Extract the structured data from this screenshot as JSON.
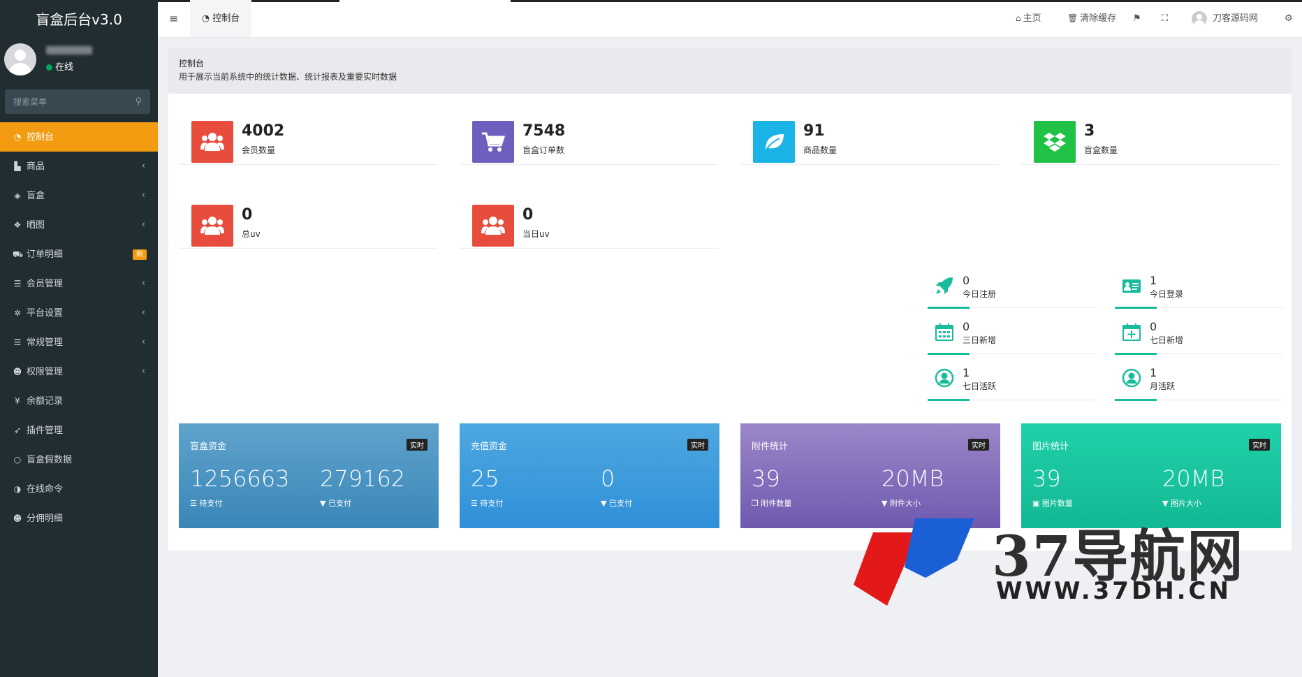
{
  "app": {
    "title": "盲盒后台v3.0"
  },
  "user": {
    "status": "在线",
    "top_name": "刀客源码网"
  },
  "sidebar": {
    "search_placeholder": "搜索菜单",
    "items": [
      {
        "label": "控制台",
        "icon": "dashboard-icon",
        "glyph": "◔",
        "chevron": "",
        "badge": ""
      },
      {
        "label": "商品",
        "icon": "shopping-bag-icon",
        "glyph": "▙",
        "chevron": "‹",
        "badge": ""
      },
      {
        "label": "盲盒",
        "icon": "cube-icon",
        "glyph": "◈",
        "chevron": "‹",
        "badge": ""
      },
      {
        "label": "晒图",
        "icon": "dropbox-icon",
        "glyph": "❖",
        "chevron": "‹",
        "badge": ""
      },
      {
        "label": "订单明细",
        "icon": "cart-icon",
        "glyph": "⛟",
        "chevron": "",
        "badge": "新"
      },
      {
        "label": "会员管理",
        "icon": "list-icon",
        "glyph": "☰",
        "chevron": "‹",
        "badge": ""
      },
      {
        "label": "平台设置",
        "icon": "cog-icon",
        "glyph": "✲",
        "chevron": "‹",
        "badge": ""
      },
      {
        "label": "常规管理",
        "icon": "database-icon",
        "glyph": "☰",
        "chevron": "‹",
        "badge": ""
      },
      {
        "label": "权限管理",
        "icon": "group-icon",
        "glyph": "☻",
        "chevron": "‹",
        "badge": ""
      },
      {
        "label": "余额记录",
        "icon": "yen-icon",
        "glyph": "¥",
        "chevron": "",
        "badge": ""
      },
      {
        "label": "插件管理",
        "icon": "rocket-icon",
        "glyph": "➶",
        "chevron": "",
        "badge": ""
      },
      {
        "label": "盲盒假数据",
        "icon": "circle-icon",
        "glyph": "○",
        "chevron": "",
        "badge": ""
      },
      {
        "label": "在线命令",
        "icon": "adjust-icon",
        "glyph": "◑",
        "chevron": "",
        "badge": ""
      },
      {
        "label": "分佣明细",
        "icon": "users-icon",
        "glyph": "☻",
        "chevron": "",
        "badge": ""
      }
    ]
  },
  "topbar": {
    "tab_label": "控制台",
    "home_label": "主页",
    "clear_cache_label": "清除缓存"
  },
  "page": {
    "title": "控制台",
    "description": "用于展示当前系统中的统计数据、统计报表及重要实时数据"
  },
  "stats": [
    {
      "value": "4002",
      "label": "会员数量",
      "color": "#e74c3c",
      "icon": "users-icon"
    },
    {
      "value": "7548",
      "label": "盲盒订单数",
      "color": "#6e5fbf",
      "icon": "cart-icon"
    },
    {
      "value": "91",
      "label": "商品数量",
      "color": "#1ab3e6",
      "icon": "leaf-icon"
    },
    {
      "value": "3",
      "label": "盲盒数量",
      "color": "#20c246",
      "icon": "dropbox-icon"
    },
    {
      "value": "0",
      "label": "总uv",
      "color": "#e74c3c",
      "icon": "users-icon"
    },
    {
      "value": "0",
      "label": "当日uv",
      "color": "#e74c3c",
      "icon": "users-icon"
    }
  ],
  "metrics": [
    {
      "value": "0",
      "label": "今日注册",
      "icon": "rocket-icon"
    },
    {
      "value": "1",
      "label": "今日登录",
      "icon": "vcard-icon"
    },
    {
      "value": "0",
      "label": "三日新增",
      "icon": "calendar-icon"
    },
    {
      "value": "0",
      "label": "七日新增",
      "icon": "calendar-plus-icon"
    },
    {
      "value": "1",
      "label": "七日活跃",
      "icon": "user-circle-icon"
    },
    {
      "value": "1",
      "label": "月活跃",
      "icon": "user-circle-icon"
    }
  ],
  "cards": [
    {
      "title": "盲盒资金",
      "tag": "实时",
      "v1": "1256663",
      "l1": "待支付",
      "v2": "279162",
      "l2": "已支付",
      "from": "#5fa3cc",
      "to": "#3a86b8"
    },
    {
      "title": "充值资金",
      "tag": "实时",
      "v1": "25",
      "l1": "待支付",
      "v2": "0",
      "l2": "已支付",
      "from": "#4ea8e0",
      "to": "#2f8fd8"
    },
    {
      "title": "附件统计",
      "tag": "实时",
      "v1": "39",
      "l1": "附件数量",
      "v2": "20MB",
      "l2": "附件大小",
      "from": "#9b87c8",
      "to": "#6f59b0"
    },
    {
      "title": "图片统计",
      "tag": "实时",
      "v1": "39",
      "l1": "图片数量",
      "v2": "20MB",
      "l2": "图片大小",
      "from": "#1fd1a8",
      "to": "#13b894"
    }
  ],
  "watermark": {
    "text": "37导航网",
    "url": "WWW.37DH.CN"
  }
}
